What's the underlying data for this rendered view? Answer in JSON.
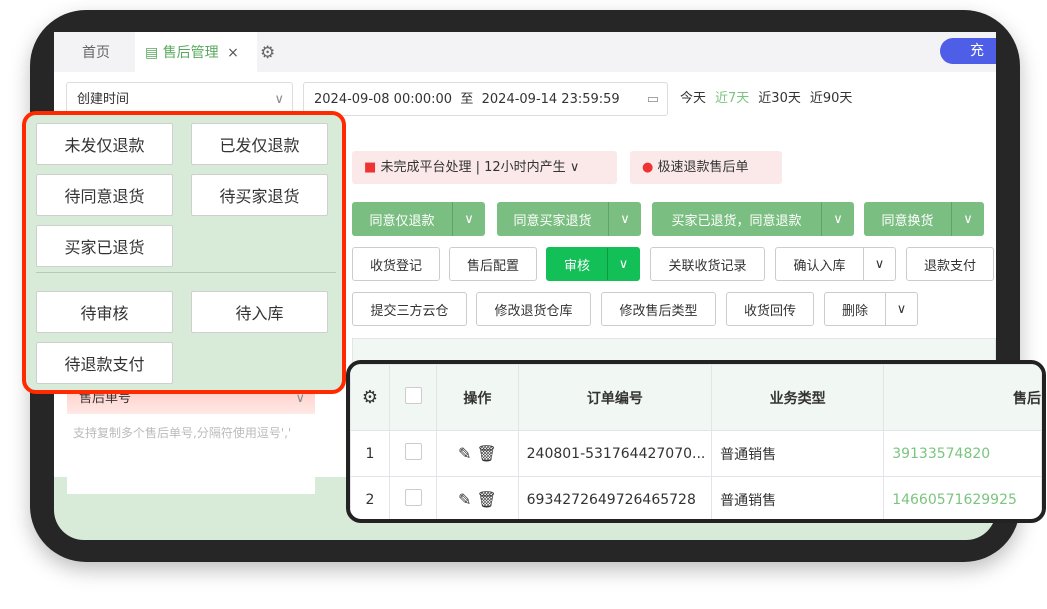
{
  "tabs": {
    "home": "首页",
    "active": "售后管理",
    "close": "×",
    "settings_icon": "gear-icon",
    "recharge": "充"
  },
  "filter": {
    "time_type": "创建时间",
    "start": "2024-09-08 00:00:00",
    "sep": "至",
    "end": "2024-09-14 23:59:59",
    "quick": [
      "今天",
      "近7天",
      "近30天",
      "近90天"
    ],
    "active_quick": "近7天"
  },
  "pills": {
    "unfinished": "未完成平台处理",
    "sep": "|",
    "range": "12小时内产生",
    "fast_refund": "极速退款售后单"
  },
  "green_buttons": [
    "同意仅退款",
    "同意买家退货",
    "买家已退货，同意退款",
    "同意换货"
  ],
  "row1": {
    "receive_register": "收货登记",
    "config": "售后配置",
    "audit": "审核",
    "link_records": "关联收货记录",
    "confirm_stock": "确认入库",
    "refund_pay": "退款支付"
  },
  "row2": {
    "submit_cloud": "提交三方云仓",
    "change_warehouse": "修改退货仓库",
    "change_type": "修改售后类型",
    "receive_back": "收货回传",
    "delete": "删除"
  },
  "quick_filters": {
    "group1": [
      "未发仅退款",
      "已发仅退款",
      "待同意退货",
      "待买家退货",
      "买家已退货"
    ],
    "group2": [
      "待审核",
      "待入库",
      "待退款支付"
    ]
  },
  "search": {
    "field": "售后单号",
    "placeholder": "支持复制多个售后单号,分隔符使用逗号','"
  },
  "table": {
    "headers": [
      "操作",
      "订单编号",
      "业务类型",
      "售后"
    ],
    "rows": [
      {
        "idx": "1",
        "order": "240801-531764427070...",
        "type": "普通销售",
        "after": "39133574820"
      },
      {
        "idx": "2",
        "order": "6934272649726465728",
        "type": "普通销售",
        "after": "14660571629925"
      }
    ]
  },
  "colors": {
    "accent": "#7bbe81",
    "audit": "#13bf57",
    "highlight": "#ff2a00"
  }
}
